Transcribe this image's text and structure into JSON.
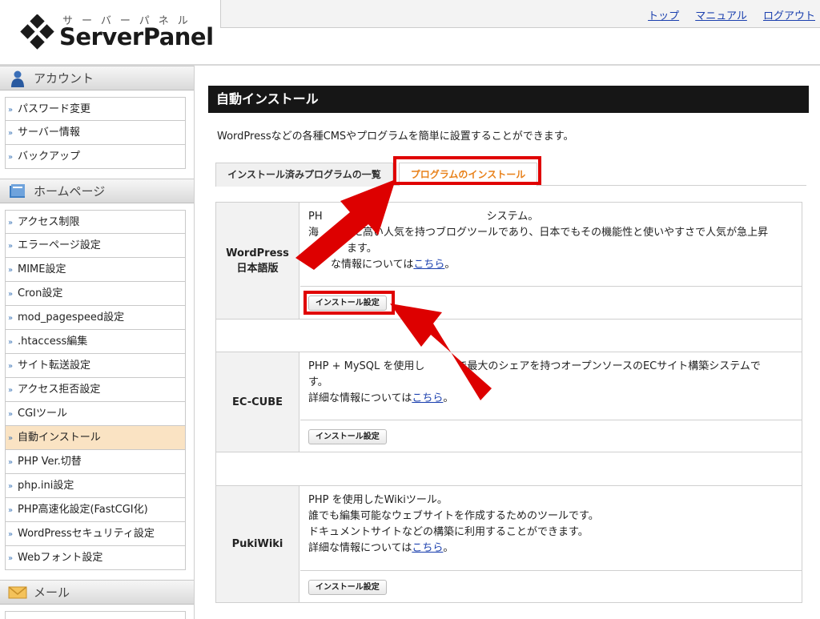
{
  "logo": {
    "kana": "サーバーパネル",
    "name": "ServerPanel"
  },
  "top_links": [
    "トップ",
    "マニュアル",
    "ログアウト"
  ],
  "sidebar": {
    "sections": [
      {
        "title": "アカウント",
        "items": [
          "パスワード変更",
          "サーバー情報",
          "バックアップ"
        ]
      },
      {
        "title": "ホームページ",
        "items": [
          "アクセス制限",
          "エラーページ設定",
          "MIME設定",
          "Cron設定",
          "mod_pagespeed設定",
          ".htaccess編集",
          "サイト転送設定",
          "アクセス拒否設定",
          "CGIツール",
          "自動インストール",
          "PHP Ver.切替",
          "php.ini設定",
          "PHP高速化設定(FastCGI化)",
          "WordPressセキュリティ設定",
          "Webフォント設定"
        ]
      },
      {
        "title": "メール",
        "items": []
      }
    ],
    "active_item": "自動インストール"
  },
  "main": {
    "title": "自動インストール",
    "description": "WordPressなどの各種CMSやプログラムを簡単に設置することができます。",
    "tabs": [
      "インストール済みプログラムの一覧",
      "プログラムのインストール"
    ],
    "active_tab": "プログラムのインストール",
    "apps": [
      {
        "name1": "WordPress",
        "name2": "日本語版",
        "lines": [
          "PH",
          "海",
          "ます。"
        ],
        "line1_tail": "システム。",
        "line2_tail": "に高い人気を持つブログツールであり、日本でもその機能性と使いやすさで人気が急上昇",
        "more_prefix": "な情報については",
        "more_link": "こちら",
        "more_suffix": "。",
        "button": "インストール設定"
      },
      {
        "name1": "EC-CUBE",
        "lines": [
          "PHP + MySQL を使用し",
          "す。"
        ],
        "line1_tail": "で最大のシェアを持つオープンソースのECサイト構築システムで",
        "more_prefix": "詳細な情報については",
        "more_link": "こちら",
        "more_suffix": "。",
        "button": "インストール設定"
      },
      {
        "name1": "PukiWiki",
        "lines": [
          "PHP を使用したWikiツール。",
          "誰でも編集可能なウェブサイトを作成するためのツールです。",
          "ドキュメントサイトなどの構築に利用することができます。"
        ],
        "more_prefix": "詳細な情報については",
        "more_link": "こちら",
        "more_suffix": "。",
        "button": "インストール設定"
      }
    ]
  },
  "colors": {
    "highlight": "#e00000",
    "active_tab_text": "#e8811a",
    "active_menu_bg": "#fae3c3",
    "title_bar": "#161616"
  },
  "icons": {
    "account": "person-icon",
    "homepage": "book-icon",
    "mail": "envelope-icon",
    "menu_item": "double-chevron-right-icon"
  }
}
